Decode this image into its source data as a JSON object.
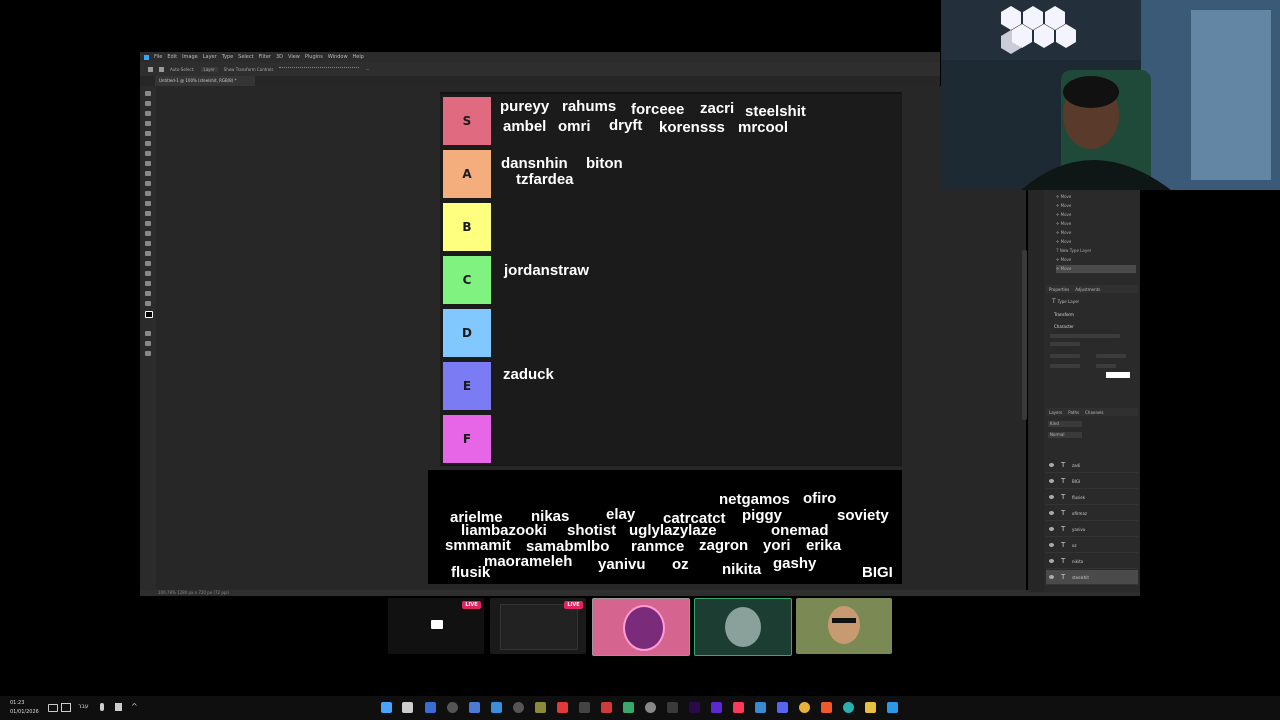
{
  "photoshop": {
    "menu": [
      "File",
      "Edit",
      "Image",
      "Layer",
      "Type",
      "Select",
      "Filter",
      "3D",
      "View",
      "Plugins",
      "Window",
      "Help"
    ],
    "options": [
      "Auto-Select:",
      "Layer",
      "Show Transform Controls"
    ],
    "doc_tab": "Untitled-1 @ 100% (steelshit, RGB/8) *",
    "status": "100.78%     1280 px x 720 px (72 ppi)",
    "history_items": [
      "Move",
      "Move",
      "Move",
      "Move",
      "Move",
      "Move",
      "New Type Layer",
      "Move",
      "Move"
    ],
    "panels": {
      "properties_tabs": [
        "Properties",
        "Adjustments"
      ],
      "properties_type": "Type Layer",
      "transform": "Transform",
      "character": "Character",
      "layers_tabs": [
        "Layers",
        "Paths",
        "Channels"
      ],
      "blend_mode": "Normal",
      "kind": "Kind",
      "layers": [
        "zadi",
        "BIGI",
        "flusiek",
        "ofirmaz",
        "yanivu",
        "oz",
        "nikita",
        "steelshit"
      ]
    }
  },
  "tierlist": {
    "tiers": [
      {
        "label": "S",
        "color": "#e06a7f"
      },
      {
        "label": "A",
        "color": "#f4ad7c"
      },
      {
        "label": "B",
        "color": "#ffff7f"
      },
      {
        "label": "C",
        "color": "#7ff27f"
      },
      {
        "label": "D",
        "color": "#80c8ff"
      },
      {
        "label": "E",
        "color": "#7b7cf4"
      },
      {
        "label": "F",
        "color": "#e766e8"
      }
    ],
    "s_names": [
      "pureyy",
      "rahums",
      "forceee",
      "zacri",
      "steelshit",
      "ambel",
      "omri",
      "dryft",
      "korensss",
      "mrcool"
    ],
    "a_names": [
      "dansnhin",
      "biton",
      "tzfardea"
    ],
    "c_names": [
      "jordanstraw"
    ],
    "e_names": [
      "zaduck"
    ],
    "pool_names": [
      "netgamos",
      "ofiro",
      "arielme",
      "nikas",
      "elay",
      "catrcatct",
      "piggy",
      "soviety",
      "liambazooki",
      "shotist",
      "uglylazylaze",
      "onemad",
      "smmamit",
      "samabmlbo",
      "ranmce",
      "zagron",
      "yori",
      "erika",
      "maorameleh",
      "yanivu",
      "oz",
      "gashy",
      "flusik",
      "nikita",
      "BIGI"
    ]
  },
  "callbar": {
    "live_label": "LIVE"
  },
  "taskbar": {
    "time": "01:23",
    "date": "01/01/2026",
    "lang": "עבר"
  }
}
